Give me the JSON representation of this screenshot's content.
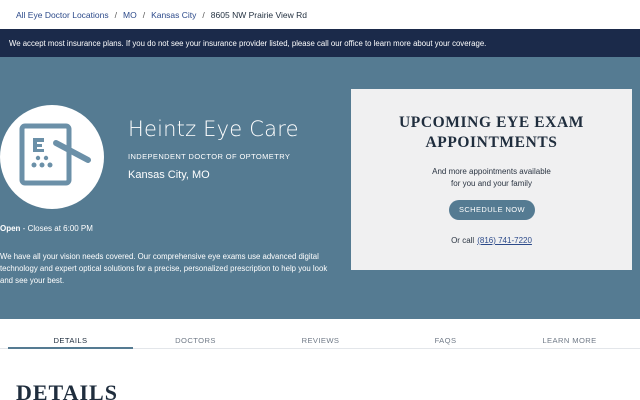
{
  "breadcrumb": {
    "items": [
      "All Eye Doctor Locations",
      "MO",
      "Kansas City"
    ],
    "separator": "/",
    "current": "8605 NW Prairie View Rd"
  },
  "banner": {
    "text": "We accept most insurance plans. If you do not see your insurance provider listed, please call our office to learn more about your coverage."
  },
  "clinic": {
    "name": "Heintz Eye Care",
    "subtitle": "INDEPENDENT DOCTOR OF OPTOMETRY",
    "city": "Kansas City, MO",
    "logo_icon": "eye-chart-icon",
    "status": "Open",
    "hours": " - Closes at 6:00 PM",
    "description": "We have all your vision needs covered. Our comprehensive eye exams use advanced digital technology and expert optical solutions for a precise, personalized prescription to help you look and see your best."
  },
  "appointments": {
    "title": "UPCOMING EYE EXAM APPOINTMENTS",
    "line1": "And more appointments available",
    "line2": "for you and your family",
    "button_label": "SCHEDULE NOW",
    "call_prefix": "Or call",
    "phone": "(816) 741-7220"
  },
  "tabs": [
    {
      "label": "DETAILS",
      "active": true
    },
    {
      "label": "DOCTORS",
      "active": false
    },
    {
      "label": "REVIEWS",
      "active": false
    },
    {
      "label": "FAQS",
      "active": false
    },
    {
      "label": "LEARN MORE",
      "active": false
    }
  ],
  "section": {
    "title": "DETAILS"
  },
  "colors": {
    "hero": "#557b92",
    "banner": "#1b2a4a",
    "card": "#f0f0f1"
  }
}
